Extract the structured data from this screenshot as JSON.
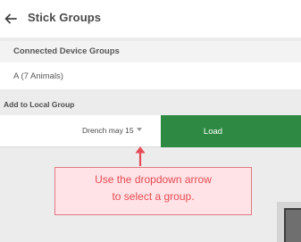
{
  "app_bar": {
    "title": "Stick Groups",
    "back_icon": "arrow-back-icon"
  },
  "connected_groups": {
    "header": "Connected Device Groups",
    "items": [
      {
        "label": "A (7 Animals)"
      }
    ]
  },
  "local_group": {
    "label": "Add to Local Group",
    "selected_value": "Drench may 15",
    "load_label": "Load"
  },
  "annotation": {
    "line1": "Use the dropdown arrow",
    "line2": "to select a group."
  },
  "colors": {
    "accent_green": "#2e8a42",
    "callout_fill": "#ffe3e6",
    "callout_text": "#e64b53"
  }
}
